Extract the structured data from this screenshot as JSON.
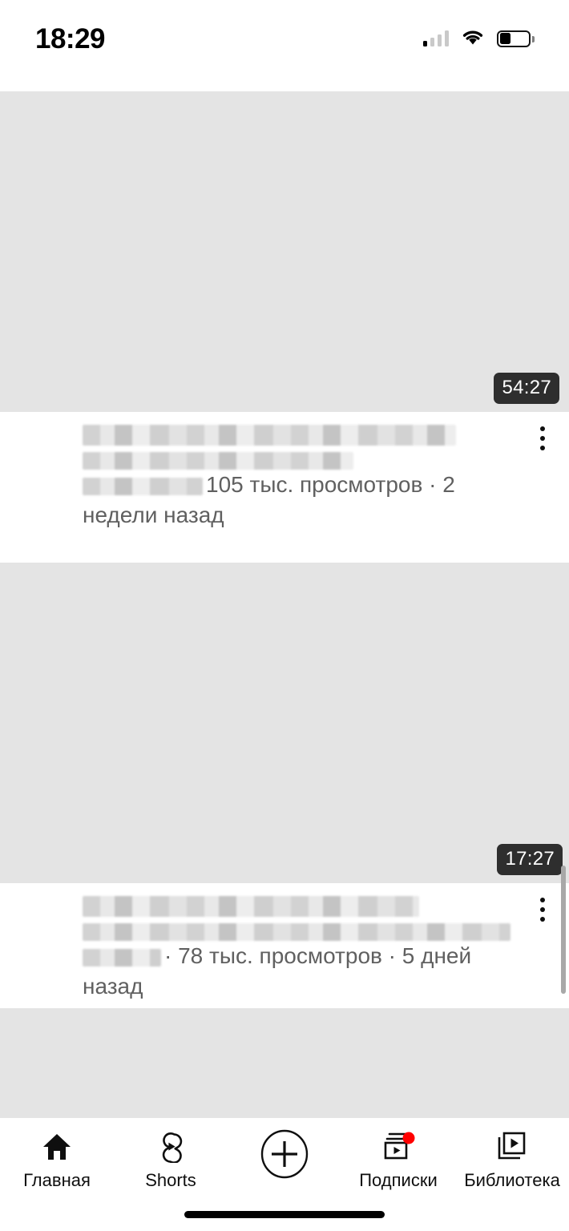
{
  "status_bar": {
    "time": "18:29",
    "signal_icon": "cellular-signal-icon",
    "wifi_icon": "wifi-icon",
    "battery_icon": "battery-low-icon"
  },
  "feed": {
    "videos": [
      {
        "title_blurred": true,
        "duration": "54:27",
        "views": "105 тыс. просмотров",
        "published": "2 недели назад",
        "separator": "·",
        "meta_line": "105 тыс. просмотров · 2 недели назад",
        "menu_icon": "more-vertical-icon"
      },
      {
        "title_blurred": true,
        "duration": "17:27",
        "views": "78 тыс. просмотров",
        "published": "5 дней назад",
        "separator": "·",
        "meta_line": "· 78 тыс. просмотров · 5 дней назад",
        "menu_icon": "more-vertical-icon"
      },
      {
        "title_blurred": true,
        "duration": "",
        "views": "",
        "published": "",
        "separator": "·",
        "meta_line": "",
        "menu_icon": "more-vertical-icon"
      }
    ]
  },
  "bottom_nav": {
    "items": [
      {
        "label": "Главная",
        "icon": "home-icon",
        "active": true,
        "badge": false
      },
      {
        "label": "Shorts",
        "icon": "shorts-icon",
        "active": false,
        "badge": false
      },
      {
        "label": "",
        "icon": "plus-circle-icon",
        "active": false,
        "badge": false
      },
      {
        "label": "Подписки",
        "icon": "subscriptions-icon",
        "active": false,
        "badge": true
      },
      {
        "label": "Библиотека",
        "icon": "library-icon",
        "active": false,
        "badge": false
      }
    ]
  },
  "colors": {
    "accent_red": "#ff0000",
    "thumbnail_placeholder": "#e4e4e4",
    "meta_text": "#606060",
    "duration_badge_bg": "#2e2e2e",
    "primary_text": "#0f0f0f"
  },
  "home_indicator": "home-indicator"
}
